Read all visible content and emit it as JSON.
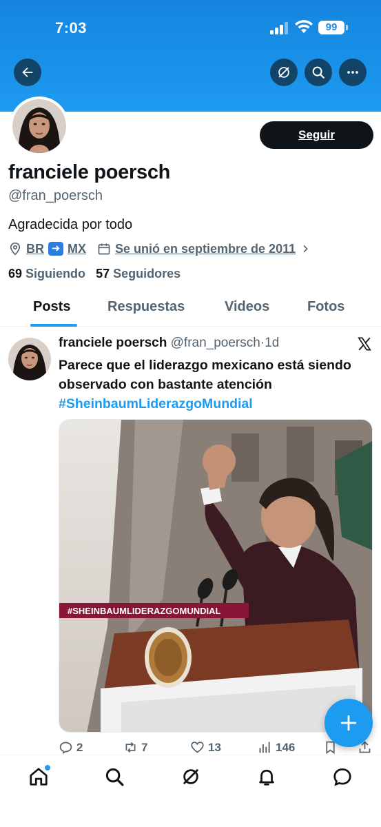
{
  "status_bar": {
    "time": "7:03",
    "battery": "99"
  },
  "header_actions": {
    "back_icon": "back-arrow-icon",
    "grok_icon": "grok-icon",
    "search_icon": "search-icon",
    "more_icon": "more-icon"
  },
  "profile": {
    "follow_label": "Seguir",
    "display_name": "franciele poersch",
    "handle": "@fran_poersch",
    "bio": "Agradecida por todo",
    "location_from": "BR",
    "location_to": "MX",
    "joined": "Se unió en septiembre de 2011",
    "following_count": "69",
    "following_label": "Siguiendo",
    "followers_count": "57",
    "followers_label": "Seguidores"
  },
  "tabs": [
    {
      "label": "Posts",
      "active": true
    },
    {
      "label": "Respuestas",
      "active": false
    },
    {
      "label": "Videos",
      "active": false
    },
    {
      "label": "Fotos",
      "active": false
    }
  ],
  "tweet": {
    "author": "franciele poersch",
    "handle": "@fran_poersch",
    "separator": "·",
    "time": "1d",
    "text": "Parece que el liderazgo mexicano está siendo observado con bastante atención",
    "hashtag": "#SheinbaumLiderazgoMundial",
    "media_banner": "#SHEINBAUMLIDERAZGOMUNDIAL",
    "replies": "2",
    "reposts": "7",
    "likes": "13",
    "views": "146"
  },
  "colors": {
    "accent": "#1d9bf0",
    "text": "#0f1419",
    "muted": "#536471",
    "banner": "#1d9bf0"
  }
}
